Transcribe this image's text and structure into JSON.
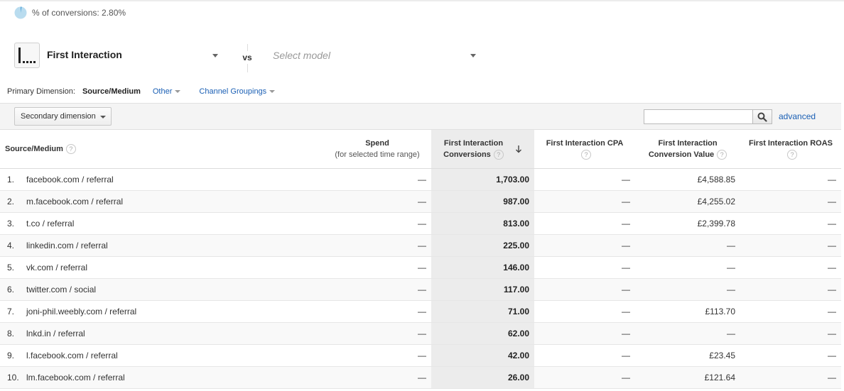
{
  "conversion_summary": {
    "text": "% of conversions: 2.80%"
  },
  "model_selector": {
    "selected_model": "First Interaction",
    "vs_label": "vs",
    "compare_placeholder": "Select model"
  },
  "primary_dimension": {
    "label": "Primary Dimension:",
    "active": "Source/Medium",
    "other": "Other",
    "channel_groupings": "Channel Groupings"
  },
  "toolbar": {
    "secondary_dimension": "Secondary dimension",
    "search_value": "",
    "advanced": "advanced"
  },
  "table": {
    "headers": {
      "source_medium": "Source/Medium",
      "spend": "Spend",
      "spend_sub": "(for selected time range)",
      "conversions_l1": "First Interaction",
      "conversions_l2": "Conversions",
      "cpa": "First Interaction CPA",
      "value_l1": "First Interaction",
      "value_l2": "Conversion Value",
      "roas": "First Interaction ROAS",
      "help": "?"
    },
    "rows": [
      {
        "num": "1.",
        "source": "facebook.com / referral",
        "spend": "—",
        "conversions": "1,703.00",
        "cpa": "—",
        "value": "£4,588.85",
        "roas": "—"
      },
      {
        "num": "2.",
        "source": "m.facebook.com / referral",
        "spend": "—",
        "conversions": "987.00",
        "cpa": "—",
        "value": "£4,255.02",
        "roas": "—"
      },
      {
        "num": "3.",
        "source": "t.co / referral",
        "spend": "—",
        "conversions": "813.00",
        "cpa": "—",
        "value": "£2,399.78",
        "roas": "—"
      },
      {
        "num": "4.",
        "source": "linkedin.com / referral",
        "spend": "—",
        "conversions": "225.00",
        "cpa": "—",
        "value": "—",
        "roas": "—"
      },
      {
        "num": "5.",
        "source": "vk.com / referral",
        "spend": "—",
        "conversions": "146.00",
        "cpa": "—",
        "value": "—",
        "roas": "—"
      },
      {
        "num": "6.",
        "source": "twitter.com / social",
        "spend": "—",
        "conversions": "117.00",
        "cpa": "—",
        "value": "—",
        "roas": "—"
      },
      {
        "num": "7.",
        "source": "joni-phil.weebly.com / referral",
        "spend": "—",
        "conversions": "71.00",
        "cpa": "—",
        "value": "£113.70",
        "roas": "—"
      },
      {
        "num": "8.",
        "source": "lnkd.in / referral",
        "spend": "—",
        "conversions": "62.00",
        "cpa": "—",
        "value": "—",
        "roas": "—"
      },
      {
        "num": "9.",
        "source": "l.facebook.com / referral",
        "spend": "—",
        "conversions": "42.00",
        "cpa": "—",
        "value": "£23.45",
        "roas": "—"
      },
      {
        "num": "10.",
        "source": "lm.facebook.com / referral",
        "spend": "—",
        "conversions": "26.00",
        "cpa": "—",
        "value": "£121.64",
        "roas": "—"
      }
    ]
  },
  "colors": {
    "link": "#1a5fb4",
    "pie_light": "#b9dcef",
    "pie_dark": "#4a9fd8",
    "sorted_column_bg": "#ececec"
  },
  "icons": {
    "pie": "pie-chart-icon",
    "model": "first-interaction-model-icon",
    "search": "search-icon",
    "sort": "sort-descending-arrow-icon",
    "help": "help-circle-icon"
  }
}
